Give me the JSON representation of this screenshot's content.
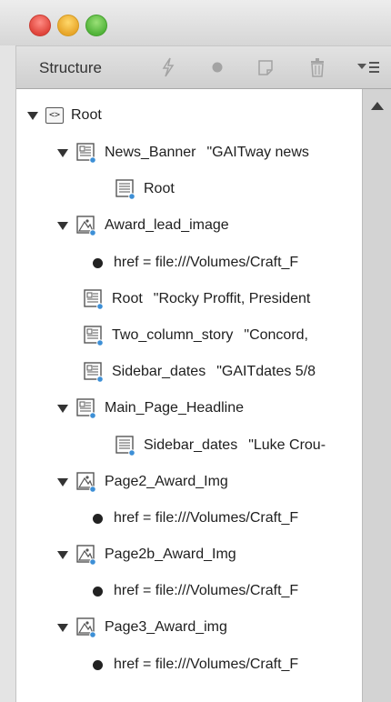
{
  "panel": {
    "title": "Structure",
    "toolbar_icons": [
      "lightning-icon",
      "dot-icon",
      "new-element-icon",
      "trash-icon",
      "panel-menu-icon"
    ]
  },
  "tree": [
    {
      "type": "root",
      "label": "Root"
    },
    {
      "type": "text",
      "label": "News_Banner",
      "value": "\"GAITway news"
    },
    {
      "type": "story",
      "label": "Root",
      "value": ""
    },
    {
      "type": "graphic",
      "label": "Award_lead_image",
      "value": ""
    },
    {
      "type": "attr",
      "label": "href = file:///Volumes/Craft_F"
    },
    {
      "type": "text",
      "label": "Root",
      "value": "\"Rocky Proffit, President"
    },
    {
      "type": "text",
      "label": "Two_column_story",
      "value": "\"Concord,"
    },
    {
      "type": "text",
      "label": "Sidebar_dates",
      "value": "\"GAITdates  5/8"
    },
    {
      "type": "text",
      "label": "Main_Page_Headline",
      "value": ""
    },
    {
      "type": "story",
      "label": "Sidebar_dates",
      "value": "\"Luke Crou-"
    },
    {
      "type": "graphic",
      "label": "Page2_Award_Img",
      "value": ""
    },
    {
      "type": "attr",
      "label": "href = file:///Volumes/Craft_F"
    },
    {
      "type": "graphic",
      "label": "Page2b_Award_Img",
      "value": ""
    },
    {
      "type": "attr",
      "label": "href = file:///Volumes/Craft_F"
    },
    {
      "type": "graphic",
      "label": "Page3_Award_img",
      "value": ""
    },
    {
      "type": "attr",
      "label": "href = file:///Volumes/Craft_F"
    }
  ],
  "colors": {
    "icon_accent": "#3d8fd6",
    "panel_bg": "#ffffff"
  }
}
